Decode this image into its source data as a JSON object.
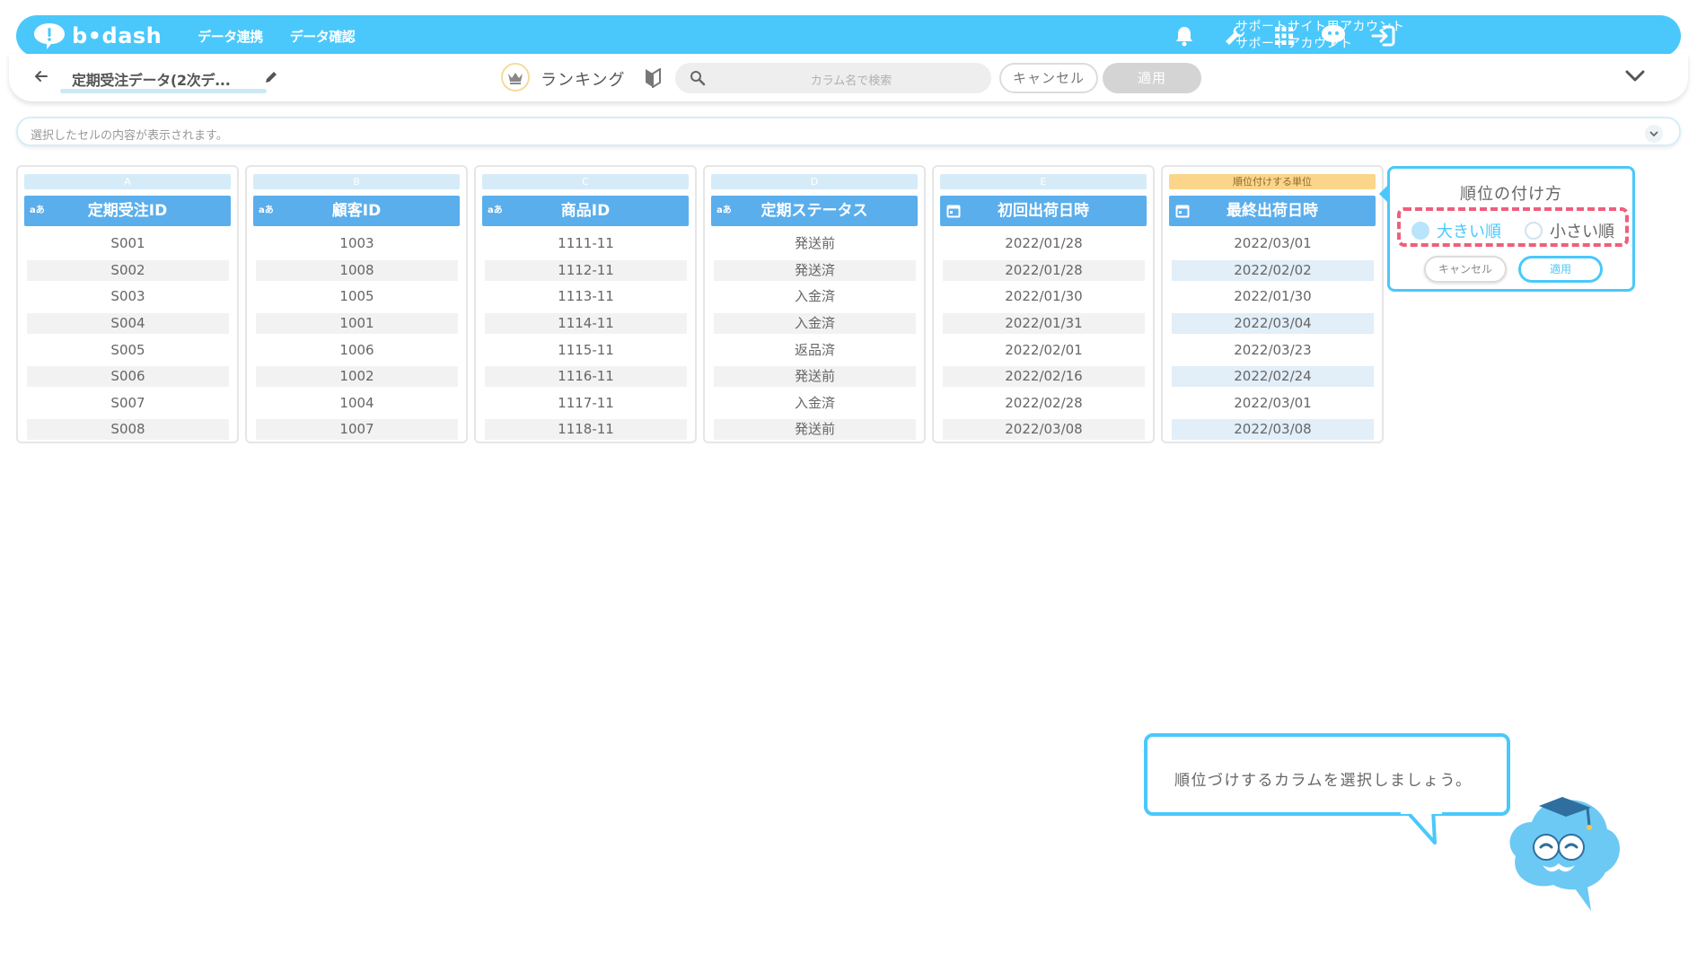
{
  "app": {
    "logo_text": "b•dash",
    "nav": [
      "データ連携",
      "データ確認"
    ],
    "account_line1": "サポートサイト用アカウント",
    "account_line2": "サポートアカウント",
    "icons": [
      "bell-icon",
      "wrench-icon",
      "grid-icon",
      "chat-bot-icon",
      "logout-icon"
    ],
    "accent_color": "#4ac8fb"
  },
  "toolbar": {
    "sheet_name": "定期受注データ(2次デ...",
    "mode_label": "ランキング",
    "search_placeholder": "カラム名で検索",
    "cancel_label": "キャンセル",
    "apply_label": "適用"
  },
  "cellbar": {
    "placeholder": "選択したセルの内容が表示されます。"
  },
  "columns": [
    {
      "letter": "A",
      "type": "text",
      "type_label": "aあ",
      "header": "定期受注ID",
      "cells": [
        "S001",
        "S002",
        "S003",
        "S004",
        "S005",
        "S006",
        "S007",
        "S008"
      ]
    },
    {
      "letter": "B",
      "type": "text",
      "type_label": "aあ",
      "header": "顧客ID",
      "cells": [
        "1003",
        "1008",
        "1005",
        "1001",
        "1006",
        "1002",
        "1004",
        "1007"
      ]
    },
    {
      "letter": "C",
      "type": "text",
      "type_label": "aあ",
      "header": "商品ID",
      "cells": [
        "1111-11",
        "1112-11",
        "1113-11",
        "1114-11",
        "1115-11",
        "1116-11",
        "1117-11",
        "1118-11"
      ]
    },
    {
      "letter": "D",
      "type": "text",
      "type_label": "aあ",
      "header": "定期ステータス",
      "cells": [
        "発送前",
        "発送済",
        "入金済",
        "入金済",
        "返品済",
        "発送前",
        "入金済",
        "発送前"
      ]
    },
    {
      "letter": "E",
      "type": "date",
      "type_label": "",
      "header": "初回出荷日時",
      "cells": [
        "2022/01/28",
        "2022/01/28",
        "2022/01/30",
        "2022/01/31",
        "2022/02/01",
        "2022/02/16",
        "2022/02/28",
        "2022/03/08"
      ]
    },
    {
      "letter": "順位付けする単位",
      "type": "date",
      "type_label": "",
      "header": "最終出荷日時",
      "cells": [
        "2022/03/01",
        "2022/02/02",
        "2022/01/30",
        "2022/03/04",
        "2022/03/23",
        "2022/02/24",
        "2022/03/01",
        "2022/03/08"
      ]
    }
  ],
  "ranking_popover": {
    "title": "順位の付け方",
    "option_desc": "大きい順",
    "option_asc": "小さい順",
    "selected": "大きい順",
    "cancel_label": "キャンセル",
    "apply_label": "適用"
  },
  "guide": {
    "message": "順位づけするカラムを選択しましょう。"
  }
}
